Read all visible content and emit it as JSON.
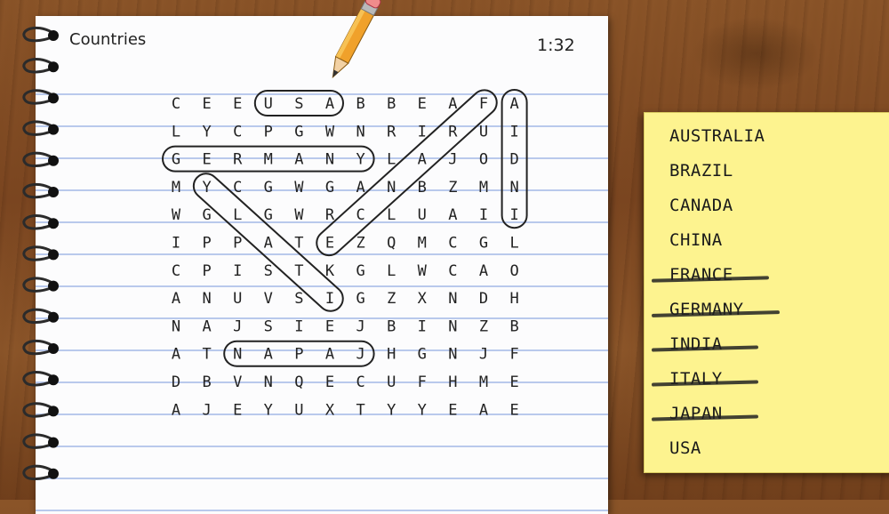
{
  "header": {
    "title": "Countries",
    "timer": "1:32"
  },
  "grid": {
    "rows": [
      [
        "C",
        "E",
        "E",
        "U",
        "S",
        "A",
        "B",
        "B",
        "E",
        "A",
        "F",
        "A"
      ],
      [
        "L",
        "Y",
        "C",
        "P",
        "G",
        "W",
        "N",
        "R",
        "I",
        "R",
        "U",
        "I"
      ],
      [
        "G",
        "E",
        "R",
        "M",
        "A",
        "N",
        "Y",
        "L",
        "A",
        "J",
        "O",
        "D"
      ],
      [
        "M",
        "Y",
        "C",
        "G",
        "W",
        "G",
        "A",
        "N",
        "B",
        "Z",
        "M",
        "N"
      ],
      [
        "W",
        "G",
        "L",
        "G",
        "W",
        "R",
        "C",
        "L",
        "U",
        "A",
        "I",
        "I"
      ],
      [
        "I",
        "P",
        "P",
        "A",
        "T",
        "E",
        "Z",
        "Q",
        "M",
        "C",
        "G",
        "L"
      ],
      [
        "C",
        "P",
        "I",
        "S",
        "T",
        "K",
        "G",
        "L",
        "W",
        "C",
        "A",
        "O"
      ],
      [
        "A",
        "N",
        "U",
        "V",
        "S",
        "I",
        "G",
        "Z",
        "X",
        "N",
        "D",
        "H"
      ],
      [
        "N",
        "A",
        "J",
        "S",
        "I",
        "E",
        "J",
        "B",
        "I",
        "N",
        "Z",
        "B"
      ],
      [
        "A",
        "T",
        "N",
        "A",
        "P",
        "A",
        "J",
        "H",
        "G",
        "N",
        "J",
        "F"
      ],
      [
        "D",
        "B",
        "V",
        "N",
        "Q",
        "E",
        "C",
        "U",
        "F",
        "H",
        "M",
        "E"
      ],
      [
        "A",
        "J",
        "E",
        "Y",
        "U",
        "X",
        "T",
        "Y",
        "Y",
        "E",
        "A",
        "E"
      ]
    ],
    "found": [
      {
        "word": "USA",
        "from": [
          0,
          3
        ],
        "to": [
          0,
          5
        ]
      },
      {
        "word": "GERMANY",
        "from": [
          2,
          0
        ],
        "to": [
          2,
          6
        ]
      },
      {
        "word": "INDIA",
        "from": [
          4,
          11
        ],
        "to": [
          0,
          11
        ]
      },
      {
        "word": "ITALY",
        "from": [
          7,
          5
        ],
        "to": [
          3,
          1
        ]
      },
      {
        "word": "FRANCE",
        "from": [
          0,
          10
        ],
        "to": [
          5,
          5
        ]
      },
      {
        "word": "JAPAN",
        "from": [
          9,
          6
        ],
        "to": [
          9,
          2
        ]
      }
    ]
  },
  "words": [
    {
      "label": "AUSTRALIA",
      "found": false
    },
    {
      "label": "BRAZIL",
      "found": false
    },
    {
      "label": "CANADA",
      "found": false
    },
    {
      "label": "CHINA",
      "found": false
    },
    {
      "label": "FRANCE",
      "found": true
    },
    {
      "label": "GERMANY",
      "found": true
    },
    {
      "label": "INDIA",
      "found": true
    },
    {
      "label": "ITALY",
      "found": true
    },
    {
      "label": "JAPAN",
      "found": true
    },
    {
      "label": "USA",
      "found": false
    }
  ],
  "icons": {
    "pencil": "pencil-icon",
    "ring": "spiral-ring-icon"
  },
  "colors": {
    "paper": "#fcfcfd",
    "ruled_line": "#b9c9ec",
    "sticky_note": "#fdf38f",
    "ink": "#222222"
  }
}
